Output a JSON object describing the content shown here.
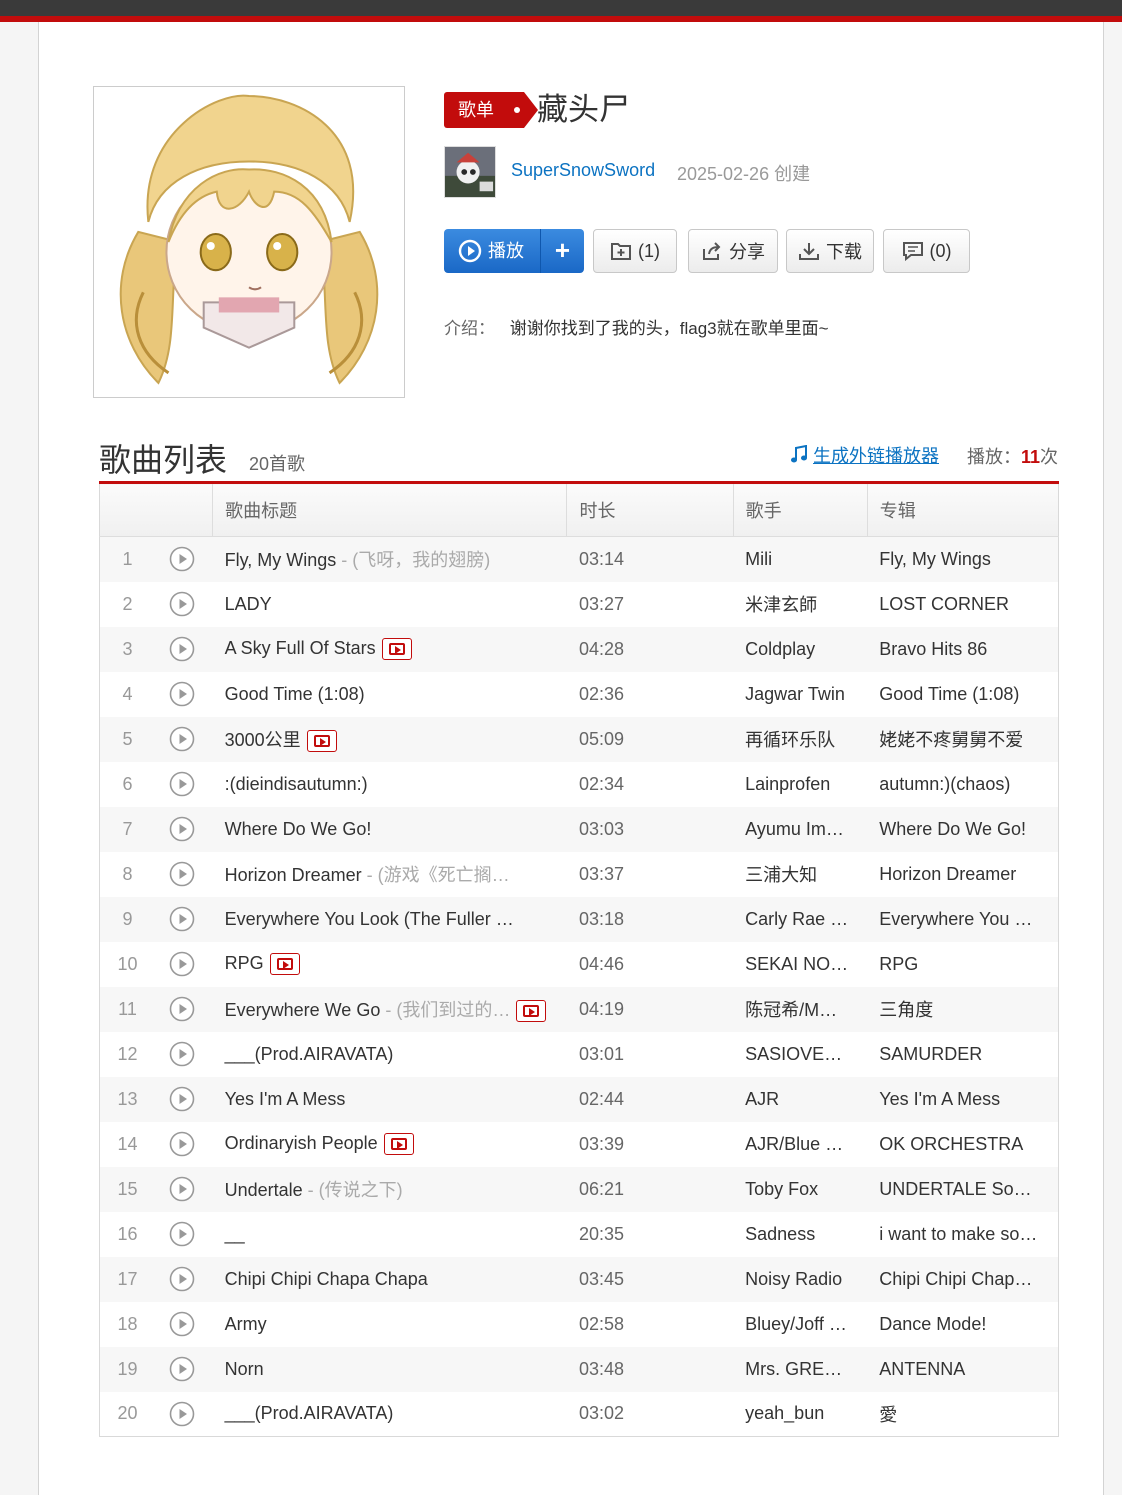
{
  "playlist": {
    "tag": "歌单",
    "name": "藏头尸",
    "creator": "SuperSnowSword",
    "created": "2025-02-26 创建",
    "actions": {
      "play": "播放",
      "plus": "+",
      "collect": "(1)",
      "share": "分享",
      "download": "下载",
      "comment": "(0)"
    },
    "intro_label": "介绍：",
    "intro_text": "谢谢你找到了我的头，flag3就在歌单里面~"
  },
  "list": {
    "title": "歌曲列表",
    "count": "20首歌",
    "ext_link": "生成外链播放器",
    "plays_label": "播放：",
    "plays_count": "11",
    "plays_unit": "次",
    "headers": [
      "",
      "歌曲标题",
      "时长",
      "歌手",
      "专辑"
    ]
  },
  "songs": [
    {
      "idx": "1",
      "title": "Fly, My Wings",
      "alias": " - (飞呀，我的翅膀)",
      "mv": false,
      "dur": "03:14",
      "artist": "Mili",
      "album": "Fly, My Wings"
    },
    {
      "idx": "2",
      "title": "LADY",
      "alias": "",
      "mv": false,
      "dur": "03:27",
      "artist": "米津玄師",
      "album": "LOST CORNER"
    },
    {
      "idx": "3",
      "title": "A Sky Full Of Stars",
      "alias": "",
      "mv": true,
      "dur": "04:28",
      "artist": "Coldplay",
      "album": "Bravo Hits 86"
    },
    {
      "idx": "4",
      "title": "Good Time (1:08)",
      "alias": "",
      "mv": false,
      "dur": "02:36",
      "artist": "Jagwar Twin",
      "album": "Good Time (1:08)"
    },
    {
      "idx": "5",
      "title": "3000公里",
      "alias": "",
      "mv": true,
      "dur": "05:09",
      "artist": "再循环乐队",
      "album": "姥姥不疼舅舅不爱"
    },
    {
      "idx": "6",
      "title": ":(dieindisautumn:)",
      "alias": "",
      "mv": false,
      "dur": "02:34",
      "artist": "Lainprofen",
      "album": "autumn:)(chaos)"
    },
    {
      "idx": "7",
      "title": "Where Do We Go!",
      "alias": "",
      "mv": false,
      "dur": "03:03",
      "artist": "Ayumu Im…",
      "album": "Where Do We Go!"
    },
    {
      "idx": "8",
      "title": "Horizon Dreamer",
      "alias": " - (游戏《死亡搁…",
      "mv": false,
      "dur": "03:37",
      "artist": "三浦大知",
      "album": "Horizon Dreamer"
    },
    {
      "idx": "9",
      "title": "Everywhere You Look (The Fuller …",
      "alias": "",
      "mv": false,
      "dur": "03:18",
      "artist": "Carly Rae …",
      "album": "Everywhere You …"
    },
    {
      "idx": "10",
      "title": "RPG",
      "alias": "",
      "mv": true,
      "dur": "04:46",
      "artist": "SEKAI NO…",
      "album": "RPG"
    },
    {
      "idx": "11",
      "title": "Everywhere We Go",
      "alias": " - (我们到过的…",
      "mv": true,
      "dur": "04:19",
      "artist": "陈冠希/M…",
      "album": "三角度"
    },
    {
      "idx": "12",
      "title": "___(Prod.AIRAVATA)",
      "alias": "",
      "mv": false,
      "dur": "03:01",
      "artist": "SASIOVE…",
      "album": "SAMURDER"
    },
    {
      "idx": "13",
      "title": "Yes I'm A Mess",
      "alias": "",
      "mv": false,
      "dur": "02:44",
      "artist": "AJR",
      "album": "Yes I'm A Mess"
    },
    {
      "idx": "14",
      "title": "Ordinaryish People",
      "alias": "",
      "mv": true,
      "dur": "03:39",
      "artist": "AJR/Blue …",
      "album": "OK ORCHESTRA"
    },
    {
      "idx": "15",
      "title": "Undertale",
      "alias": " - (传说之下)",
      "mv": false,
      "dur": "06:21",
      "artist": "Toby Fox",
      "album": "UNDERTALE So…"
    },
    {
      "idx": "16",
      "title": "__",
      "alias": "",
      "mv": false,
      "dur": "20:35",
      "artist": "Sadness",
      "album": "i want to make so…"
    },
    {
      "idx": "17",
      "title": "Chipi Chipi Chapa Chapa",
      "alias": "",
      "mv": false,
      "dur": "03:45",
      "artist": "Noisy Radio",
      "album": "Chipi Chipi Chap…"
    },
    {
      "idx": "18",
      "title": "Army",
      "alias": "",
      "mv": false,
      "dur": "02:58",
      "artist": "Bluey/Joff …",
      "album": "Dance Mode!"
    },
    {
      "idx": "19",
      "title": "Norn",
      "alias": "",
      "mv": false,
      "dur": "03:48",
      "artist": "Mrs. GRE…",
      "album": "ANTENNA"
    },
    {
      "idx": "20",
      "title": "___(Prod.AIRAVATA)",
      "alias": "",
      "mv": false,
      "dur": "03:02",
      "artist": "yeah_bun",
      "album": "愛"
    }
  ],
  "colors": {
    "accent": "#c20c0c",
    "link": "#0c73c2",
    "play_button": "#1a68c6"
  }
}
